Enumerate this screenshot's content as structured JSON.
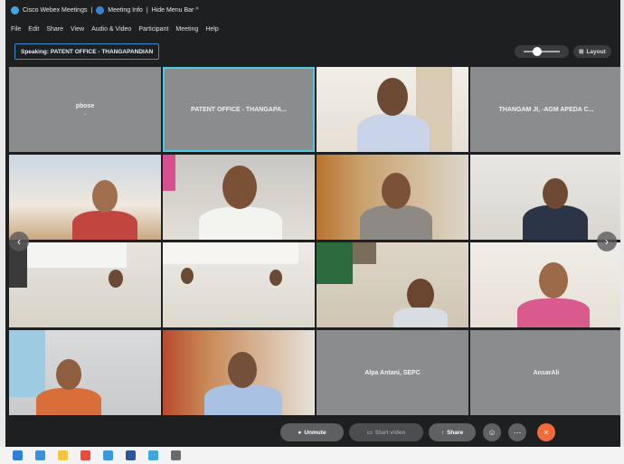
{
  "titlebar": {
    "app_title": "Cisco Webex Meetings",
    "meeting_info": "Meeting Info",
    "hide_menu": "Hide Menu Bar ^"
  },
  "menu": [
    "File",
    "Edit",
    "Share",
    "View",
    "Audio & Video",
    "Participant",
    "Meeting",
    "Help"
  ],
  "speaking": "Speaking: PATENT OFFICE - THANGAPANDIAN",
  "view": {
    "layout_label": "Layout"
  },
  "tiles": [
    {
      "name": "pbose",
      "sub": "⌄"
    },
    {
      "name": "PATENT OFFICE - THANGAPA..."
    },
    {
      "name": ""
    },
    {
      "name": "THANGAM JI, -AGM APEDA C..."
    },
    {
      "name": ""
    },
    {
      "name": ""
    },
    {
      "name": ""
    },
    {
      "name": ""
    },
    {
      "name": ""
    },
    {
      "name": ""
    },
    {
      "name": ""
    },
    {
      "name": ""
    },
    {
      "name": ""
    },
    {
      "name": ""
    },
    {
      "name": "Alpa Antani, SEPC"
    },
    {
      "name": "AnsarAli"
    }
  ],
  "controls": {
    "unmute": "Unmute",
    "start_video": "Start video",
    "share": "Share",
    "close_icon": "×"
  },
  "colors": {
    "accent": "#4fc9e0",
    "leave": "#f26b3a",
    "share": "#5f6164",
    "bg": "#1e1f21"
  }
}
